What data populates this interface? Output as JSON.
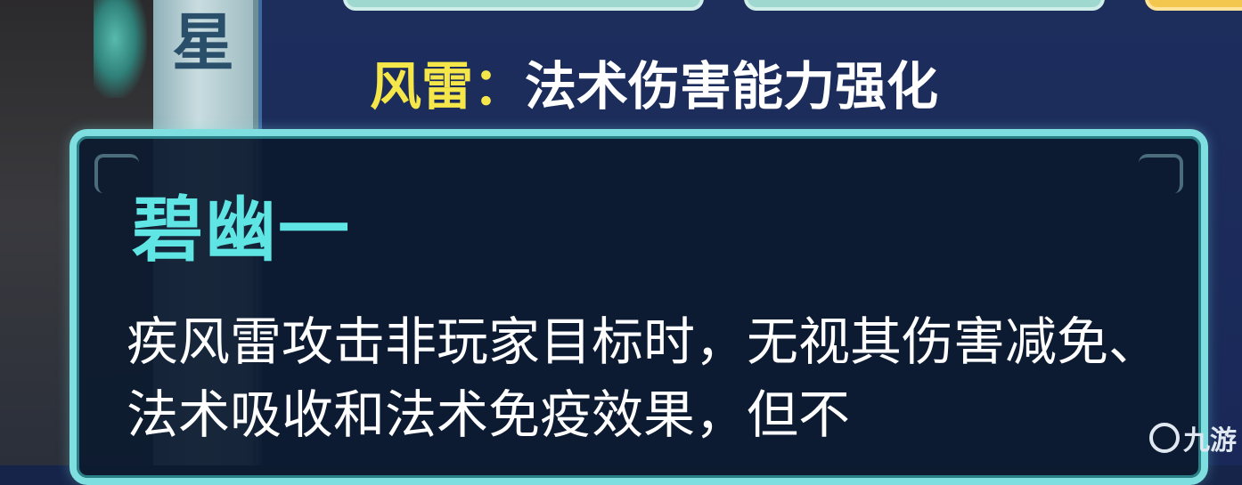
{
  "side_tab": {
    "char": "星"
  },
  "attribute": {
    "key": "风雷",
    "separator": "：",
    "value": "法术伤害能力强化"
  },
  "tooltip": {
    "title": "碧幽一",
    "body": "疾风雷攻击非玩家目标时，无视其伤害减免、法术吸收和法术免疫效果，但不"
  },
  "watermark": {
    "text": "九游"
  },
  "colors": {
    "panel": "#192858",
    "tooltip_border": "#7fdfe0",
    "title": "#5fe6e4",
    "attr_key": "#f5e64a"
  }
}
